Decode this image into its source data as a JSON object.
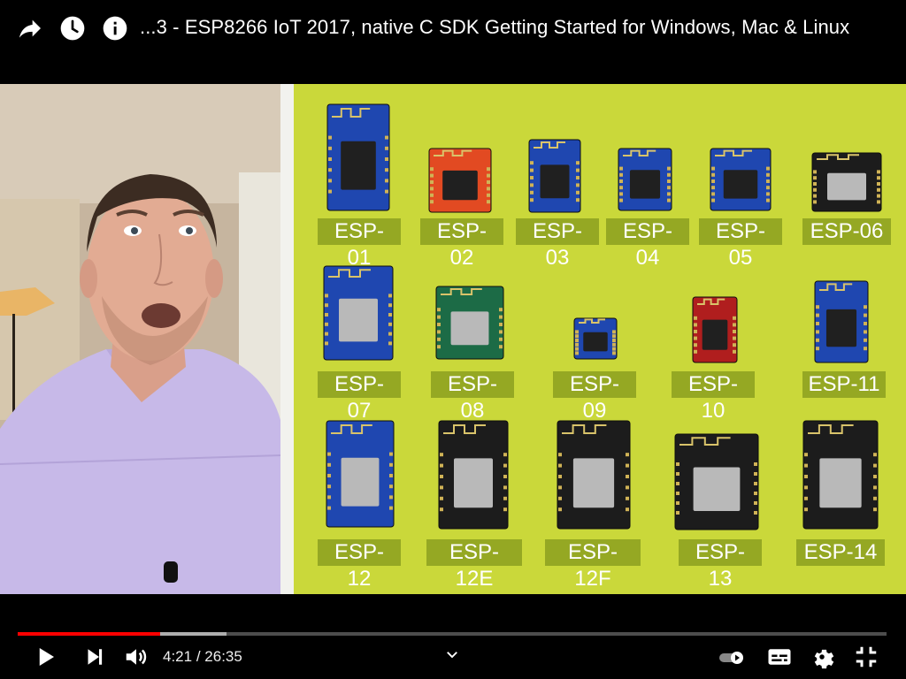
{
  "header": {
    "title": "...3 - ESP8266 IoT 2017, native C SDK Getting Started for Windows, Mac & Linux",
    "icons": [
      "share-icon",
      "watch-later-icon",
      "info-icon"
    ]
  },
  "video": {
    "modules": [
      {
        "label": "ESP-01",
        "color": "#1f47b0"
      },
      {
        "label": "ESP-02",
        "color": "#e24a22"
      },
      {
        "label": "ESP-03",
        "color": "#1f47b0"
      },
      {
        "label": "ESP-04",
        "color": "#1f47b0"
      },
      {
        "label": "ESP-05",
        "color": "#1f47b0"
      },
      {
        "label": "ESP-06",
        "color": "#1c1c1c"
      },
      {
        "label": "ESP-07",
        "color": "#1f47b0"
      },
      {
        "label": "ESP-08",
        "color": "#1c6b46"
      },
      {
        "label": "ESP-09",
        "color": "#1f47b0"
      },
      {
        "label": "ESP-10",
        "color": "#b01e1e"
      },
      {
        "label": "ESP-11",
        "color": "#1f47b0"
      },
      {
        "label": "ESP-12",
        "color": "#1f47b0"
      },
      {
        "label": "ESP-12E",
        "color": "#1c1c1c"
      },
      {
        "label": "ESP-12F",
        "color": "#1c1c1c"
      },
      {
        "label": "ESP-13",
        "color": "#1c1c1c"
      },
      {
        "label": "ESP-14",
        "color": "#1c1c1c"
      }
    ]
  },
  "player": {
    "current_time": "4:21",
    "separator": "/",
    "duration": "26:35",
    "played_fraction": 0.1636,
    "buffered_fraction": 0.24
  }
}
